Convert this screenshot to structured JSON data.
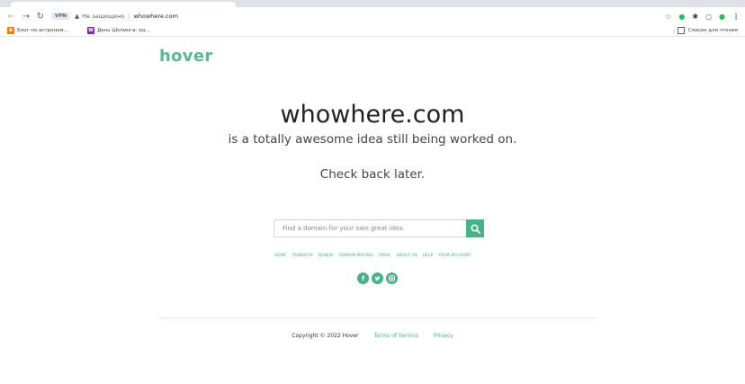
{
  "browser": {
    "vpn_badge": "VPN",
    "insecure_label": "Не защищено",
    "separator": "|",
    "url": "whowhere.com",
    "bookmarks": [
      {
        "label": "Блог по астроном..."
      },
      {
        "label": "День Шопинга: од..."
      }
    ],
    "reading_list": "Список для чтения"
  },
  "page": {
    "logo": "hover",
    "headline": "whowhere.com",
    "subline": "is a totally awesome idea still being worked on.",
    "check_back": "Check back later.",
    "search_placeholder": "Find a domain for your own great idea.",
    "nav": [
      "HOME",
      "TRANSFER",
      "RENEW",
      "DOMAIN PRICING",
      "EMAIL",
      "ABOUT US",
      "HELP",
      "YOUR ACCOUNT"
    ],
    "social": [
      "facebook-icon",
      "twitter-icon",
      "instagram-icon"
    ],
    "footer": {
      "copyright": "Copyright © 2022 Hover",
      "terms": "Terms of Service",
      "privacy": "Privacy"
    }
  },
  "colors": {
    "brand": "#45b387",
    "logo": "#5bb891"
  }
}
